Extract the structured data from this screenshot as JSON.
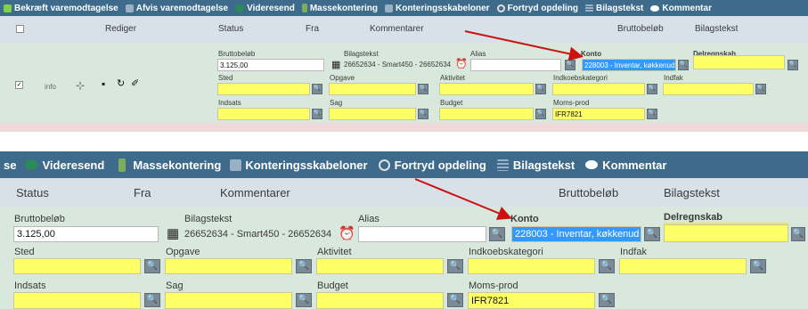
{
  "top": {
    "toolbar": [
      {
        "label": "Bekræft varemodtagelse",
        "icon": "check-icon",
        "color": "#7fd14a"
      },
      {
        "label": "Afvis varemodtagelse",
        "icon": "reject-icon",
        "color": "#9ab0c4"
      },
      {
        "label": "Videresend",
        "icon": "forward-icon",
        "color": "#2a8a5a"
      },
      {
        "label": "Massekontering",
        "icon": "stack-icon",
        "color": "#7fae5a"
      },
      {
        "label": "Konteringsskabeloner",
        "icon": "template-icon",
        "color": "#9ab0c4"
      },
      {
        "label": "Fortryd opdeling",
        "icon": "undo-icon",
        "color": "#e0e0e0"
      },
      {
        "label": "Bilagstekst",
        "icon": "lines-icon",
        "color": "#9ab0c4"
      },
      {
        "label": "Kommentar",
        "icon": "comment-icon",
        "color": "#ffffff"
      }
    ],
    "header": {
      "rediger": "Rediger",
      "status": "Status",
      "fra": "Fra",
      "kommentarer": "Kommentarer",
      "bruttobelob": "Bruttobeløb",
      "bilagstekst": "Bilagstekst"
    },
    "row": {
      "info": "info",
      "fields": {
        "bruttobelob_label": "Bruttobeløb",
        "bruttobelob_value": "3.125,00",
        "bilagstekst_label": "Bilagstekst",
        "bilagstekst_value": "26652634 - Smart450 - 26652634",
        "alias_label": "Alias",
        "konto_label": "Konto",
        "konto_value": "228003 - Inventar, køkkenud",
        "delregnskab_label": "Delregnskab",
        "sted_label": "Sted",
        "opgave_label": "Opgave",
        "aktivitet_label": "Aktivitet",
        "indkoebskategori_label": "Indkoebskategori",
        "indfak_label": "Indfak",
        "indsats_label": "Indsats",
        "sag_label": "Sag",
        "budget_label": "Budget",
        "moms_label": "Moms-prod",
        "moms_value": "IFR7821"
      }
    }
  },
  "zoom": {
    "toolbar": [
      {
        "label": "se",
        "icon": "",
        "color": ""
      },
      {
        "label": "Videresend",
        "icon": "forward-icon",
        "color": "#2a8a5a"
      },
      {
        "label": "Massekontering",
        "icon": "stack-icon",
        "color": "#7fae5a"
      },
      {
        "label": "Konteringsskabeloner",
        "icon": "template-icon",
        "color": "#9ab0c4"
      },
      {
        "label": "Fortryd opdeling",
        "icon": "undo-icon",
        "color": "#e0e0e0"
      },
      {
        "label": "Bilagstekst",
        "icon": "lines-icon",
        "color": "#9ab0c4"
      },
      {
        "label": "Kommentar",
        "icon": "comment-icon",
        "color": "#ffffff"
      }
    ],
    "header": {
      "status": "Status",
      "fra": "Fra",
      "kommentarer": "Kommentarer",
      "bruttobelob": "Bruttobeløb",
      "bilagstekst": "Bilagstekst"
    },
    "fields": {
      "bruttobelob_label": "Bruttobeløb",
      "bruttobelob_value": "3.125,00",
      "bilagstekst_label": "Bilagstekst",
      "bilagstekst_value": "26652634 - Smart450 - 26652634",
      "alias_label": "Alias",
      "konto_label": "Konto",
      "konto_value": "228003 - Inventar, køkkenud",
      "delregnskab_label": "Delregnskab",
      "sted_label": "Sted",
      "opgave_label": "Opgave",
      "aktivitet_label": "Aktivitet",
      "indkoebskategori_label": "Indkoebskategori",
      "indfak_label": "Indfak",
      "indsats_label": "Indsats",
      "sag_label": "Sag",
      "budget_label": "Budget",
      "moms_label": "Moms-prod",
      "moms_value": "IFR7821"
    }
  },
  "colors": {
    "toolbar": "#3e6b8c",
    "highlight": "#ffff66",
    "selection": "#3399ff",
    "arrow": "#cc1111",
    "row": "#d8e8dc"
  }
}
